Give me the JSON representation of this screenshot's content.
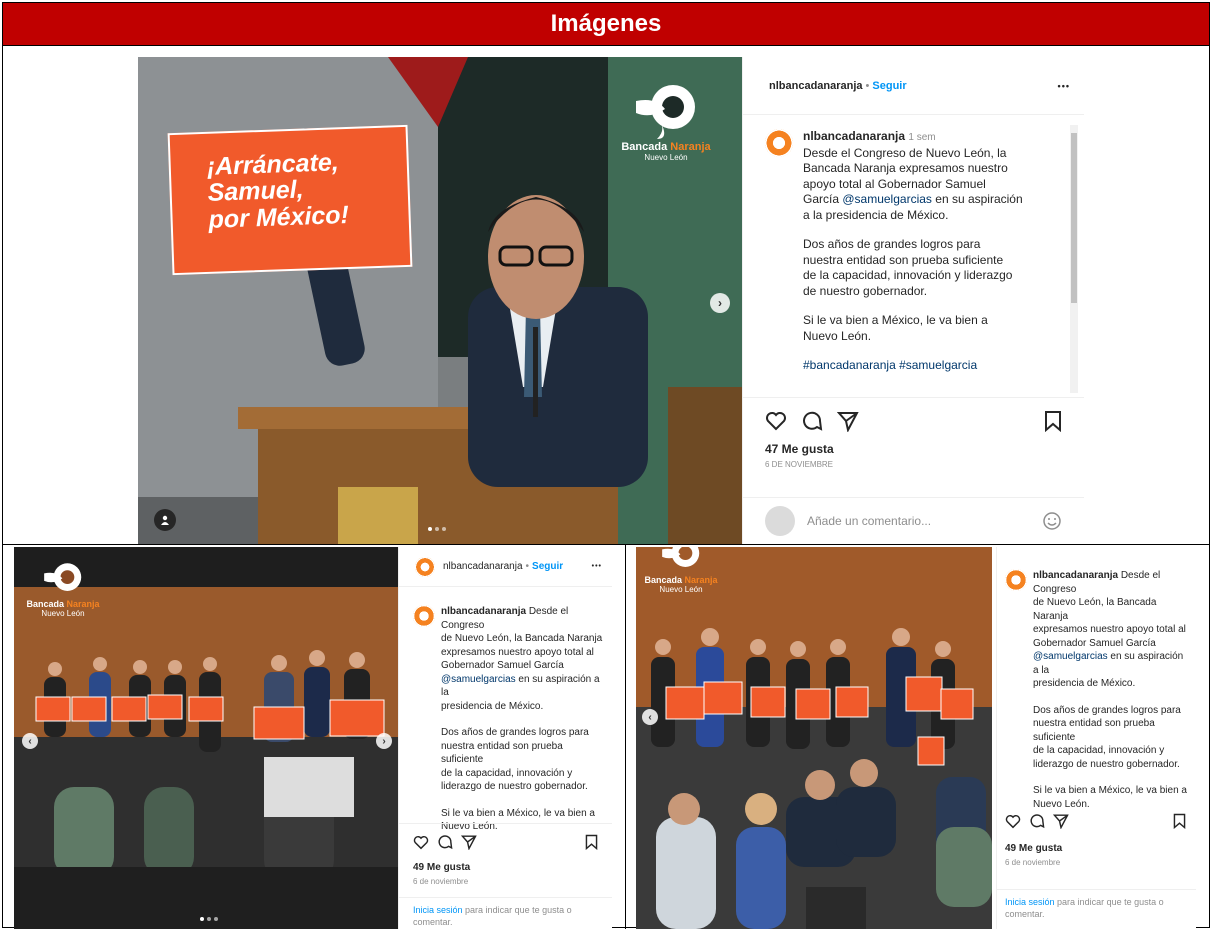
{
  "header": {
    "title": "Imágenes"
  },
  "post_main": {
    "username": "nlbancadanaranja",
    "follow_label": "Seguir",
    "more_label": "•••",
    "time_ago": "1 sem",
    "caption_lines": [
      "Desde el Congreso de Nuevo León, la",
      "Bancada Naranja expresamos nuestro",
      "apoyo total al Gobernador Samuel",
      "García"
    ],
    "mention": "@samuelgarcias",
    "caption_after_mention": "en su aspiración",
    "caption_line_5": "a la presidencia de México.",
    "paragraph2": [
      "Dos años de grandes logros para",
      "nuestra entidad son prueba suficiente",
      "de la capacidad, innovación y liderazgo",
      "de nuestro gobernador."
    ],
    "paragraph3": [
      "Si le va bien a México, le va bien a",
      "Nuevo León."
    ],
    "hashtags": "#bancadanaranja #samuelgarcia",
    "likes": "47 Me gusta",
    "date": "6 DE NOVIEMBRE",
    "comment_placeholder": "Añade un comentario...",
    "sign_text": [
      "¡Arráncate,",
      "Samuel,",
      "por México!"
    ],
    "logo_brand_1": "Bancada",
    "logo_brand_2": "Naranja",
    "logo_sub": "Nuevo León"
  },
  "post_left": {
    "username": "nlbancadanaranja",
    "follow_label": "Seguir",
    "more_label": "•••",
    "caption_lines": [
      "Desde el Congreso",
      "de Nuevo León, la Bancada Naranja",
      "expresamos nuestro apoyo total al",
      "Gobernador Samuel García"
    ],
    "mention": "@samuelgarcias",
    "caption_after_mention": "en su aspiración a la",
    "caption_line_6": "presidencia de México.",
    "paragraph2": [
      "Dos años de grandes logros para",
      "nuestra entidad son prueba suficiente",
      "de la capacidad, innovación y",
      "liderazgo de nuestro gobernador."
    ],
    "paragraph3": [
      "Si le va bien a México, le va bien a",
      "Nuevo León."
    ],
    "likes": "49 Me gusta",
    "date": "6 de noviembre",
    "login_link": "Inicia sesión",
    "login_rest": "para indicar que te gusta o",
    "login_rest_2": "comentar.",
    "logo_brand_1": "Bancada",
    "logo_brand_2": "Naranja",
    "logo_sub": "Nuevo León"
  },
  "post_right": {
    "username": "nlbancadanaranja",
    "caption_lines": [
      "Desde el Congreso",
      "de Nuevo León, la Bancada Naranja",
      "expresamos nuestro apoyo total al",
      "Gobernador Samuel García"
    ],
    "mention": "@samuelgarcias",
    "caption_after_mention": "en su aspiración a la",
    "caption_line_6": "presidencia de México.",
    "paragraph2": [
      "Dos años de grandes logros para",
      "nuestra entidad son prueba suficiente",
      "de la capacidad, innovación y",
      "liderazgo de nuestro gobernador."
    ],
    "paragraph3": [
      "Si le va bien a México, le va bien a",
      "Nuevo León."
    ],
    "likes": "49 Me gusta",
    "date": "6 de noviembre",
    "login_link": "Inicia sesión",
    "login_rest": "para indicar que te gusta o",
    "login_rest_2": "comentar.",
    "logo_brand_1": "Bancada",
    "logo_brand_2": "Naranja",
    "logo_sub": "Nuevo León"
  },
  "colors": {
    "header_bg": "#c00000",
    "brand_orange": "#f58220",
    "sign_orange": "#f15a2b",
    "link_blue": "#0095f6"
  },
  "icons": [
    "heart-icon",
    "comment-icon",
    "share-icon",
    "bookmark-icon",
    "emoji-icon",
    "next-icon",
    "prev-icon",
    "more-icon",
    "user-tag-icon"
  ]
}
